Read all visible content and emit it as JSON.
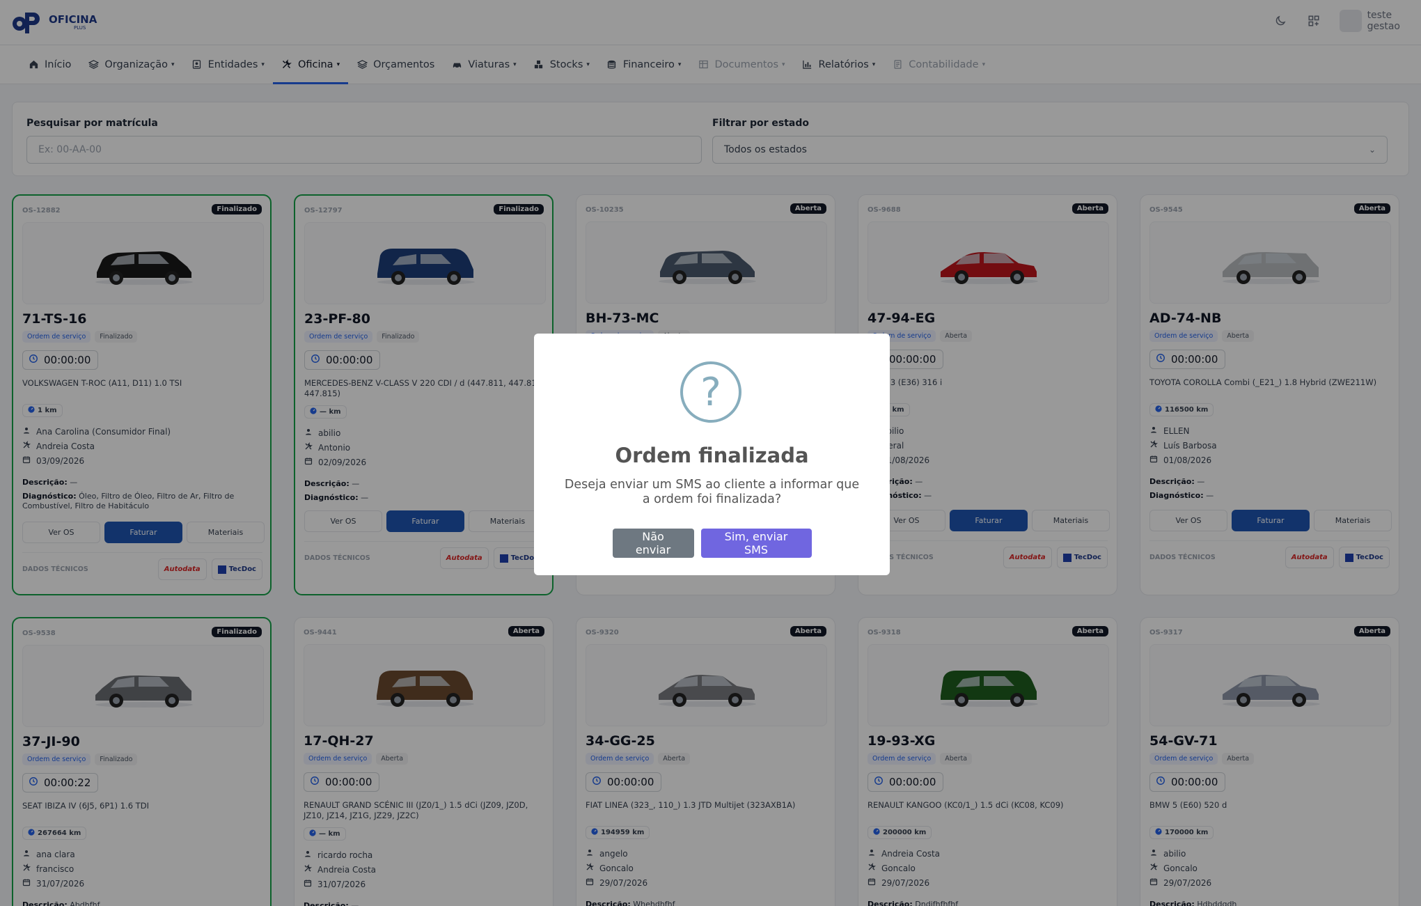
{
  "app": {
    "logo_text": "OFICINA",
    "logo_sub": "PLUS",
    "user_name": "teste",
    "user_role": "gestao"
  },
  "nav": [
    {
      "label": "Início",
      "icon": "home-icon",
      "chevron": false,
      "state": "normal"
    },
    {
      "label": "Organização",
      "icon": "layers-icon",
      "chevron": true,
      "state": "normal"
    },
    {
      "label": "Entidades",
      "icon": "id-card-icon",
      "chevron": true,
      "state": "normal"
    },
    {
      "label": "Oficina",
      "icon": "tools-icon",
      "chevron": true,
      "state": "active"
    },
    {
      "label": "Orçamentos",
      "icon": "layers-icon",
      "chevron": false,
      "state": "normal"
    },
    {
      "label": "Viaturas",
      "icon": "car-icon",
      "chevron": true,
      "state": "normal"
    },
    {
      "label": "Stocks",
      "icon": "boxes-icon",
      "chevron": true,
      "state": "normal"
    },
    {
      "label": "Financeiro",
      "icon": "coins-icon",
      "chevron": true,
      "state": "normal"
    },
    {
      "label": "Documentos",
      "icon": "document-icon",
      "chevron": true,
      "state": "disabled"
    },
    {
      "label": "Relatórios",
      "icon": "chart-icon",
      "chevron": true,
      "state": "normal"
    },
    {
      "label": "Contabilidade",
      "icon": "ledger-icon",
      "chevron": true,
      "state": "disabled"
    }
  ],
  "filters": {
    "search_label": "Pesquisar por matrícula",
    "search_placeholder": "Ex: 00-AA-00",
    "state_label": "Filtrar por estado",
    "state_value": "Todos os estados"
  },
  "labels": {
    "type_tag": "Ordem de serviço",
    "ver_os": "Ver OS",
    "faturar": "Faturar",
    "materiais": "Materiais",
    "dados_tecnicos": "DADOS TÉCNICOS",
    "descricao": "Descrição:",
    "diagnostico": "Diagnóstico:",
    "autodata": "Autodata",
    "tecdoc": "TecDoc"
  },
  "cards": [
    {
      "os": "OS-12882",
      "status": "Finalizado",
      "plate": "71-TS-16",
      "time": "00:00:00",
      "model": "VOLKSWAGEN T-ROC (A11, D11) 1.0 TSI",
      "km": "1 km",
      "client": "Ana Carolina (Consumidor Final)",
      "mechanic": "Andreia Costa",
      "date": "03/09/2026",
      "descricao": "—",
      "diagnostico": "Óleo, Filtro de Óleo, Filtro de Ar, Filtro de Combustível, Filtro de Habitáculo",
      "car_color": "#1a1a1a"
    },
    {
      "os": "OS-12797",
      "status": "Finalizado",
      "plate": "23-PF-80",
      "time": "00:00:00",
      "model": "MERCEDES-BENZ V-CLASS V 220 CDI / d (447.811, 447.813, 447.815)",
      "km": "— km",
      "client": "abilio",
      "mechanic": "Antonio",
      "date": "02/09/2026",
      "descricao": "—",
      "diagnostico": "—",
      "car_color": "#1d3f7a"
    },
    {
      "os": "OS-10235",
      "status": "Aberta",
      "plate": "BH-73-MC",
      "time": "00:00:00",
      "model": "",
      "km": "",
      "client": "",
      "mechanic": "",
      "date": "",
      "descricao": "",
      "diagnostico": "",
      "car_color": "#4b5b6e"
    },
    {
      "os": "OS-9688",
      "status": "Aberta",
      "plate": "47-94-EG",
      "time": "00:00:00",
      "model": "BMW 3 (E36) 316 i",
      "km": "— km",
      "client": "abilio",
      "mechanic": "Geral",
      "date": "01/08/2026",
      "descricao": "—",
      "diagnostico": "—",
      "car_color": "#c0161d"
    },
    {
      "os": "OS-9545",
      "status": "Aberta",
      "plate": "AD-74-NB",
      "time": "00:00:00",
      "model": "TOYOTA COROLLA Combi (_E21_) 1.8 Hybrid (ZWE211W)",
      "km": "116500 km",
      "client": "ELLEN",
      "mechanic": "Luís Barbosa",
      "date": "01/08/2026",
      "descricao": "—",
      "diagnostico": "—",
      "car_color": "#b9bcc0"
    },
    {
      "os": "OS-9538",
      "status": "Finalizado",
      "plate": "37-JI-90",
      "time": "00:00:22",
      "model": "SEAT IBIZA IV (6J5, 6P1) 1.6 TDI",
      "km": "267664 km",
      "client": "ana clara",
      "mechanic": "francisco",
      "date": "31/07/2026",
      "descricao": "Abdhfhf",
      "diagnostico": "",
      "car_color": "#6b6e73"
    },
    {
      "os": "OS-9441",
      "status": "Aberta",
      "plate": "17-QH-27",
      "time": "00:00:00",
      "model": "RENAULT GRAND SCÉNIC III (JZ0/1_) 1.5 dCi (JZ09, JZ0D, JZ10, JZ14, JZ1G, JZ29, JZ2C)",
      "km": "— km",
      "client": "ricardo rocha",
      "mechanic": "Andreia Costa",
      "date": "31/07/2026",
      "descricao": "—",
      "diagnostico": "",
      "car_color": "#6b4a2f"
    },
    {
      "os": "OS-9320",
      "status": "Aberta",
      "plate": "34-GG-25",
      "time": "00:00:00",
      "model": "FIAT LINEA (323_, 110_) 1.3 JTD Multijet (323AXB1A)",
      "km": "194959 km",
      "client": "angelo",
      "mechanic": "Goncalo",
      "date": "29/07/2026",
      "descricao": "Whehdhfhf",
      "diagnostico": "",
      "car_color": "#7a7c80"
    },
    {
      "os": "OS-9318",
      "status": "Aberta",
      "plate": "19-93-XG",
      "time": "00:00:00",
      "model": "RENAULT KANGOO (KC0/1_) 1.5 dCi (KC08, KC09)",
      "km": "200000 km",
      "client": "Andreia Costa",
      "mechanic": "Goncalo",
      "date": "29/07/2026",
      "descricao": "Dndjfhfhfhf",
      "diagnostico": "",
      "car_color": "#1f5e1f"
    },
    {
      "os": "OS-9317",
      "status": "Aberta",
      "plate": "54-GV-71",
      "time": "00:00:00",
      "model": "BMW 5 (E60) 520 d",
      "km": "170000 km",
      "client": "abilio",
      "mechanic": "Goncalo",
      "date": "29/07/2026",
      "descricao": "Hdbddgdh",
      "diagnostico": "",
      "car_color": "#8e96a8"
    }
  ],
  "modal": {
    "icon": "question-icon",
    "title": "Ordem finalizada",
    "text": "Deseja enviar um SMS ao cliente a informar que a ordem foi finalizada?",
    "cancel_label": "Não enviar",
    "confirm_label": "Sim, enviar SMS"
  },
  "colors": {
    "primary": "#1e56b3",
    "active_nav": "#2563eb",
    "finalized_border": "#16a34a",
    "modal_confirm": "#7066e0",
    "modal_cancel": "#6e7881"
  }
}
